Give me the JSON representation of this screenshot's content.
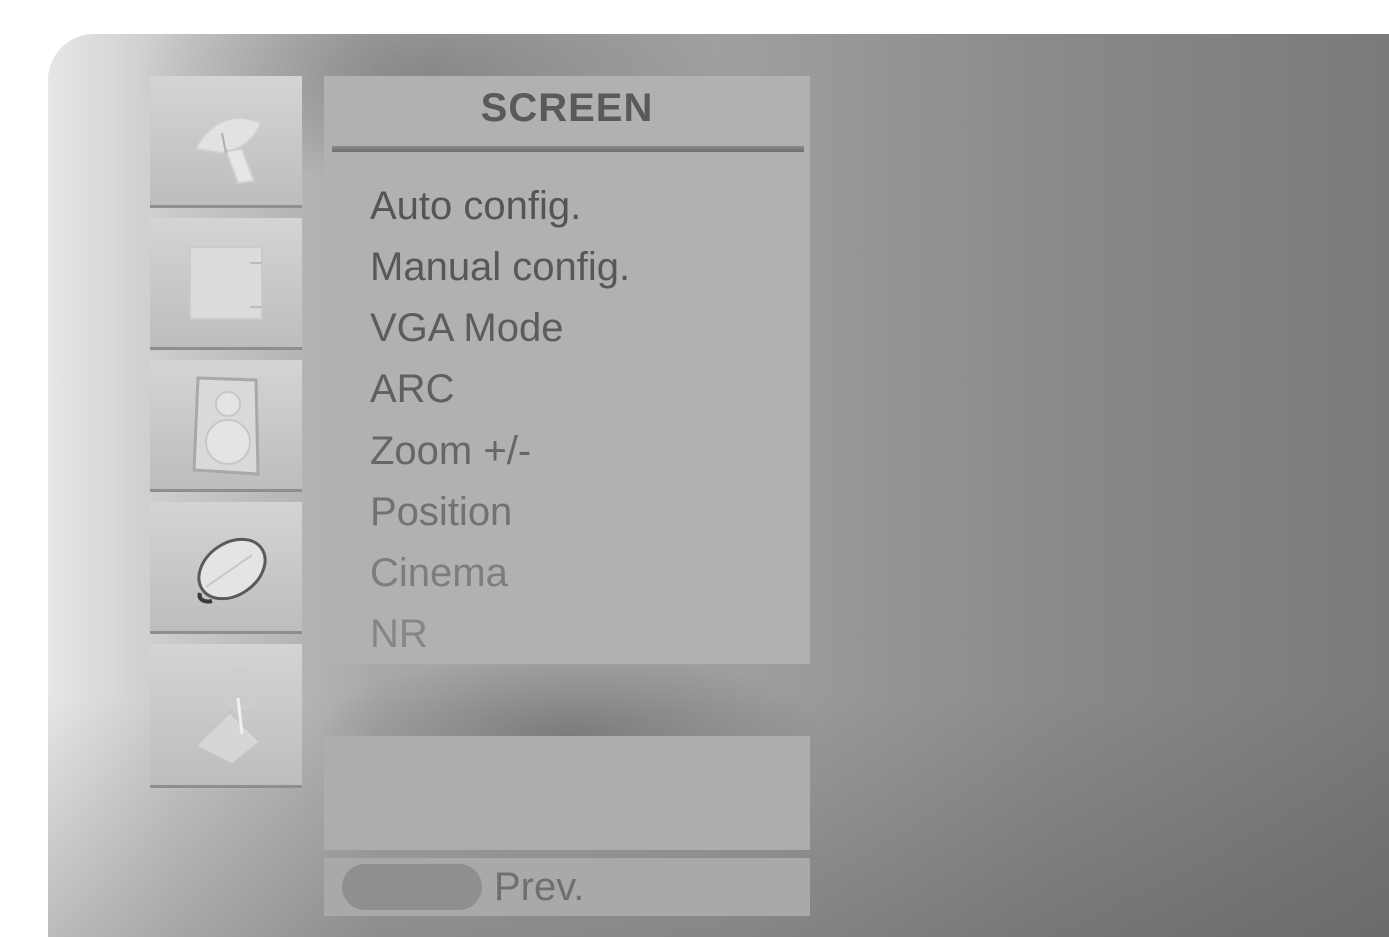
{
  "menu": {
    "title": "SCREEN",
    "items": [
      {
        "label": "Auto config.",
        "color": "#555555"
      },
      {
        "label": "Manual config.",
        "color": "#585858"
      },
      {
        "label": "VGA Mode",
        "color": "#5c5c5c"
      },
      {
        "label": "ARC",
        "color": "#606060"
      },
      {
        "label": "Zoom +/-",
        "color": "#666666"
      },
      {
        "label": "Position",
        "color": "#727272"
      },
      {
        "label": "Cinema",
        "color": "#7d7d7d"
      },
      {
        "label": "NR",
        "color": "#868686"
      }
    ]
  },
  "sidebar": {
    "icons": [
      "satellite-dish-icon",
      "picture-icon",
      "speaker-icon",
      "clock-icon",
      "key-icon"
    ]
  },
  "footer": {
    "prev_label": "Prev."
  }
}
